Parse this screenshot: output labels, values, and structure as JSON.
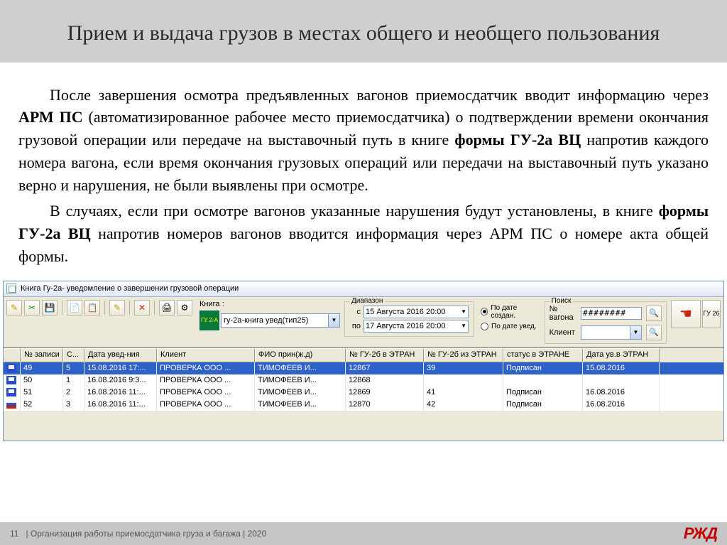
{
  "slide": {
    "title": "Прием и выдача грузов в местах общего и необщего пользования",
    "paragraph1_pre": "После завершения осмотра предъявленных вагонов приемосдатчик вводит информацию через ",
    "bold1": "АРМ ПС",
    "paragraph1_mid": " (автоматизированное рабочее место приемосдатчика) о подтверждении времени окончания грузовой операции или передаче на выставочный путь в книге ",
    "bold2": "формы ГУ-2а ВЦ",
    "paragraph1_post": " напротив каждого номера вагона, если время окончания грузовых операций или передачи на выставочный путь указано верно и нарушения, не были выявлены при осмотре.",
    "paragraph2_pre": "В случаях, если при осмотре вагонов указанные нарушения будут установлены, в книге ",
    "bold3": "формы ГУ-2а ВЦ",
    "paragraph2_post": " напротив номеров вагонов вводится информация через АРМ ПС о номере акта общей формы."
  },
  "app": {
    "title": "Книга Гу-2а-  уведомление о завершении грузовой операции",
    "book_label": "Книга :",
    "book_icon": "ГУ 2-А",
    "book_value": "гу-2а-книга увед(тип25)",
    "range_legend": "Диапазон",
    "range_from_label": "с",
    "range_from": "15 Августа 2016 20:00",
    "range_to_label": "по",
    "range_to": "17 Августа 2016 20:00",
    "radio1": "По дате создан.",
    "radio2": "По дате увед.",
    "search_legend": "Поиск",
    "search_wagon_label": "№ вагона",
    "search_wagon_value": "########",
    "search_client_label": "Клиент",
    "side_btn": "ГУ 26",
    "columns": [
      "№ записи",
      "С...",
      "Дата увед-ния",
      "Клиент",
      "ФИО прин(ж.д)",
      "№ ГУ-2б в ЭТРАН",
      "№ ГУ-2б из ЭТРАН",
      "статус в ЭТРАНЕ",
      "Дата ув.в ЭТРАН"
    ],
    "rows": [
      {
        "icon": "disk",
        "num": "49",
        "s": "5",
        "date": "15.08.2016 17:...",
        "client": "ПРОВЕРКА  ООО ...",
        "fio": "ТИМОФЕЕВ И...",
        "gu_in": "12867",
        "gu_out": "39",
        "status": "Подписан",
        "date2": "15.08.2016",
        "selected": true
      },
      {
        "icon": "disk",
        "num": "50",
        "s": "1",
        "date": "16.08.2016 9:3...",
        "client": "ПРОВЕРКА  ООО ...",
        "fio": "ТИМОФЕЕВ И...",
        "gu_in": "12868",
        "gu_out": "",
        "status": "",
        "date2": "",
        "selected": false
      },
      {
        "icon": "disk",
        "num": "51",
        "s": "2",
        "date": "16.08.2016 11:...",
        "client": "ПРОВЕРКА  ООО ...",
        "fio": "ТИМОФЕЕВ И...",
        "gu_in": "12869",
        "gu_out": "41",
        "status": "Подписан",
        "date2": "16.08.2016",
        "selected": false
      },
      {
        "icon": "flag",
        "num": "52",
        "s": "3",
        "date": "16.08.2016 11:...",
        "client": "ПРОВЕРКА  ООО ...",
        "fio": "ТИМОФЕЕВ И...",
        "gu_in": "12870",
        "gu_out": "42",
        "status": "Подписан",
        "date2": "16.08.2016",
        "selected": false
      }
    ]
  },
  "footer": {
    "page": "11",
    "text": "| Организация работы приемосдатчика груза и багажа | 2020",
    "logo": "РЖД"
  }
}
